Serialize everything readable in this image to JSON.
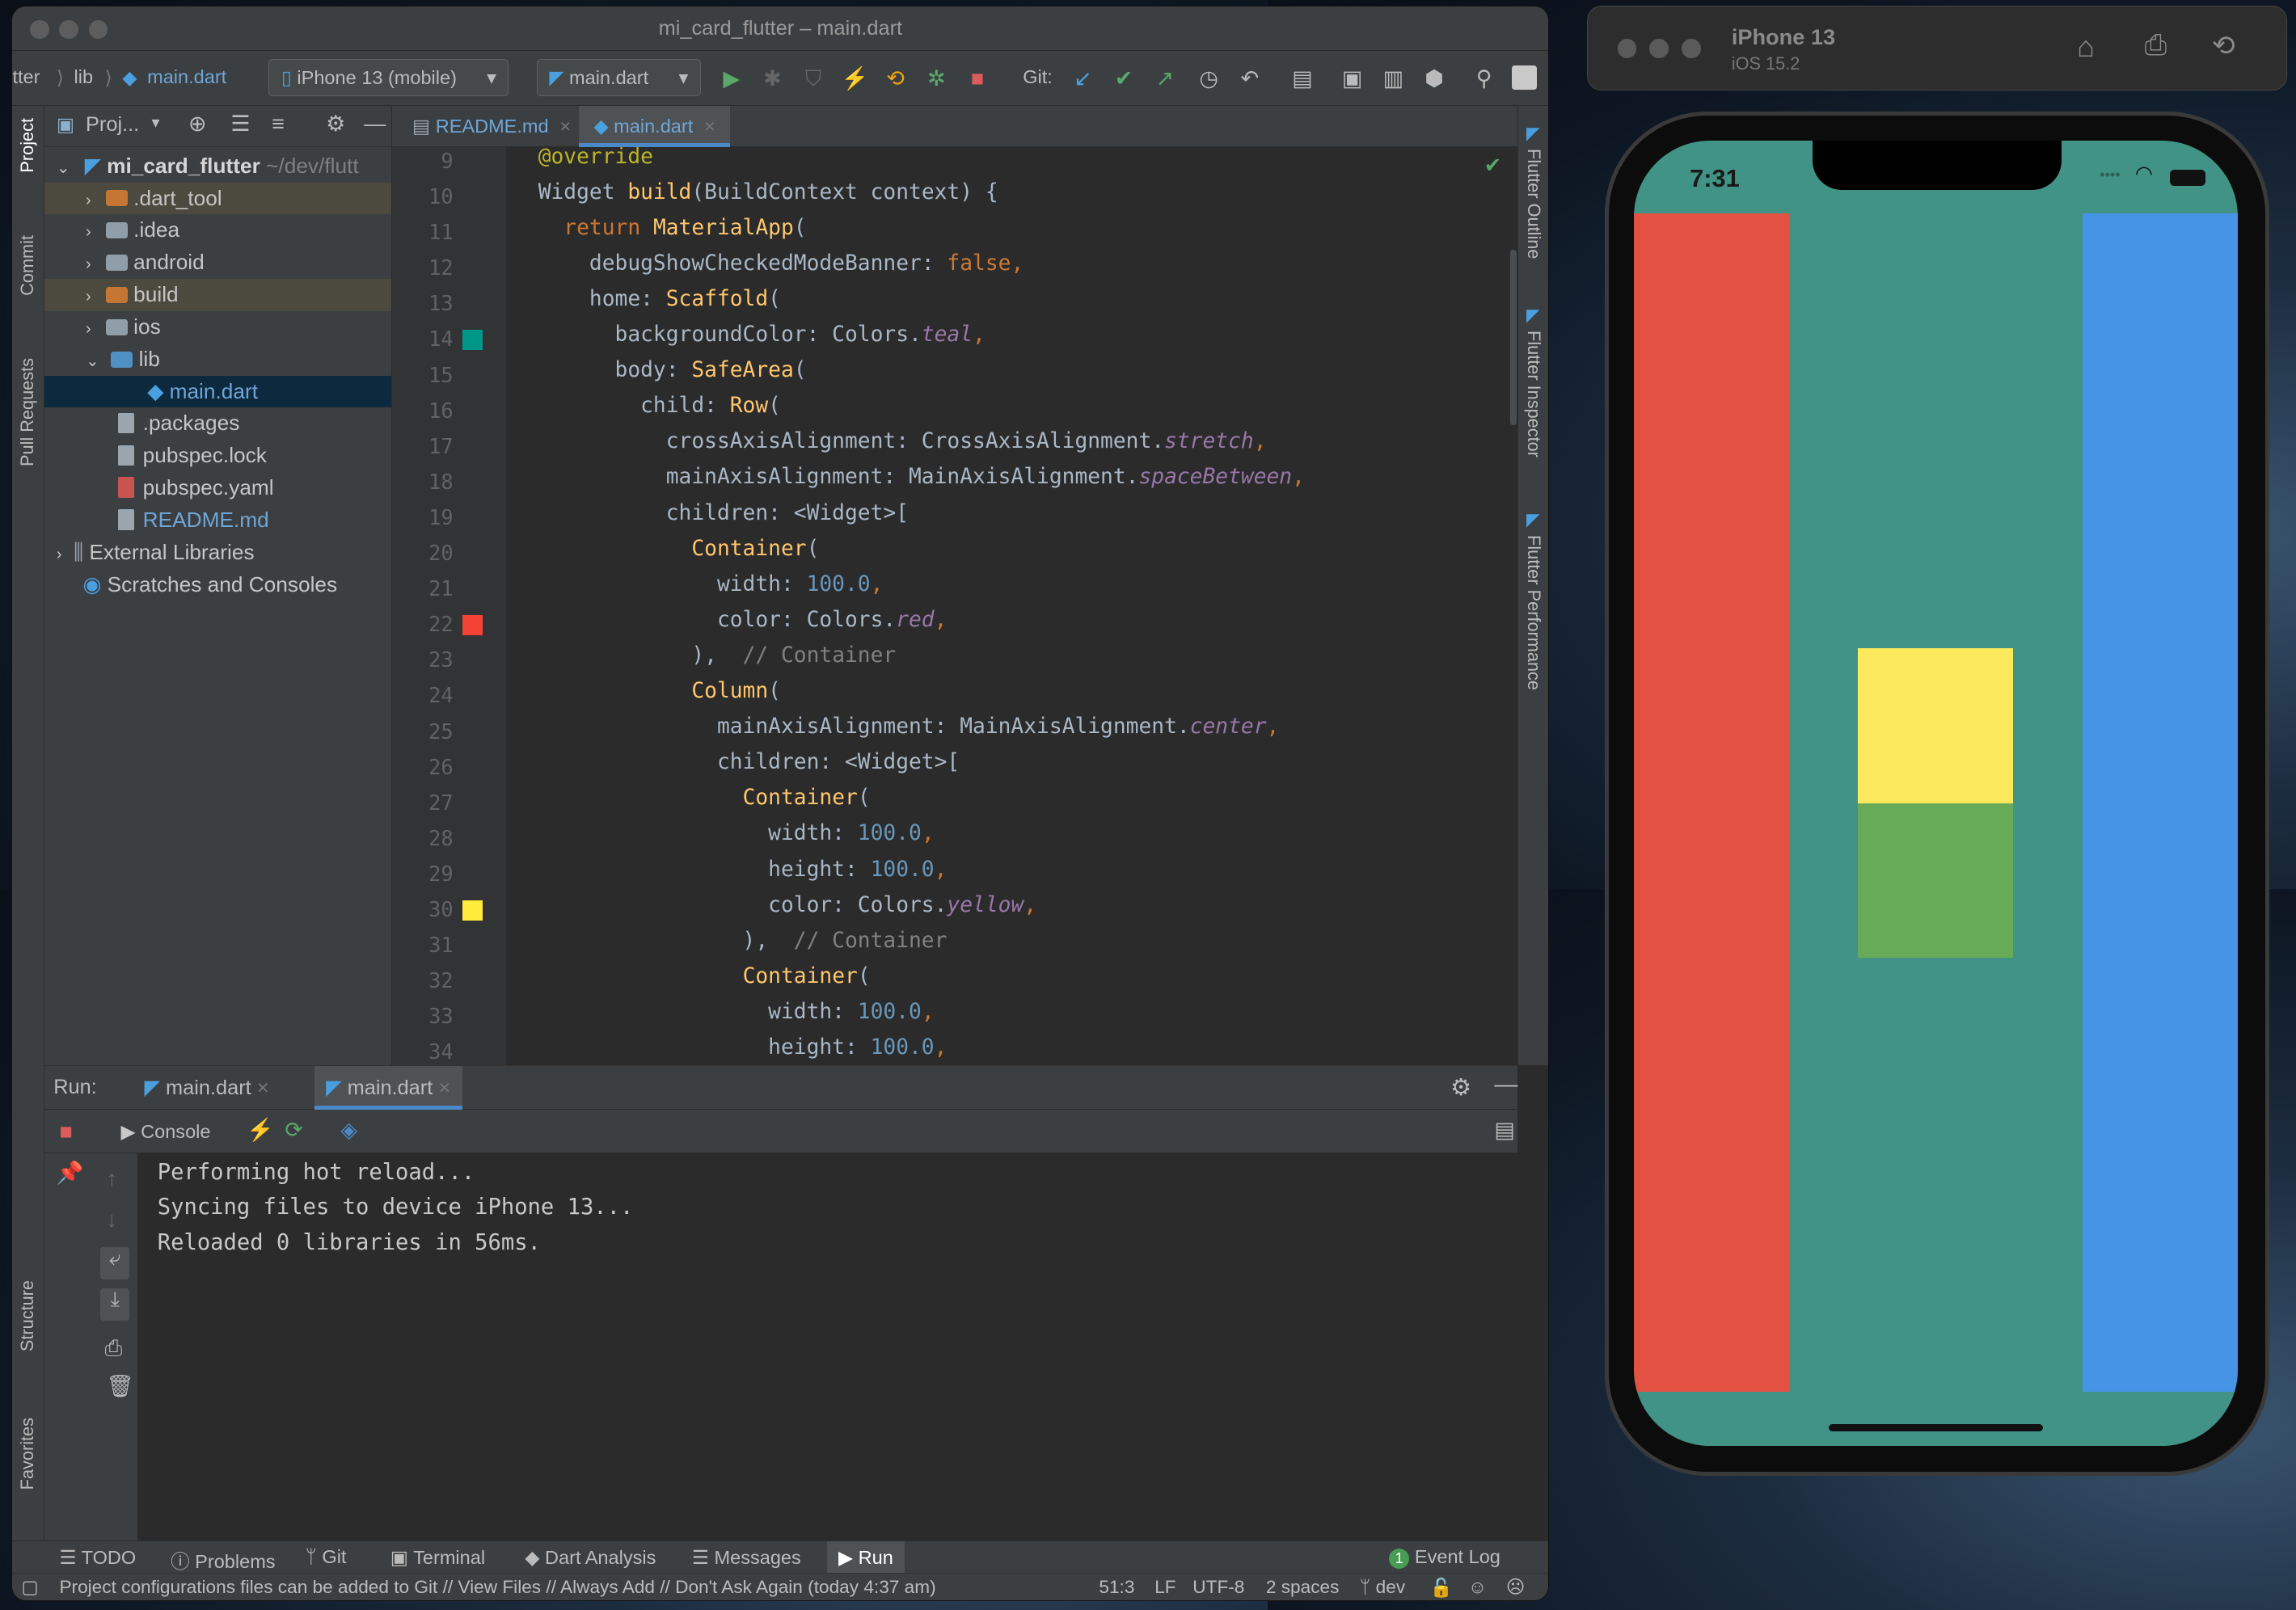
{
  "ide": {
    "window_title": "mi_card_flutter – main.dart",
    "breadcrumb": [
      "tter",
      "lib",
      "main.dart"
    ],
    "device_selector": "iPhone 13 (mobile)",
    "run_config": "main.dart",
    "git_label": "Git:"
  },
  "project_panel": {
    "header": "Proj...",
    "root_name": "mi_card_flutter",
    "root_path": "~/dev/flutt",
    "items": [
      {
        "label": ".dart_tool",
        "type": "folder",
        "color": "#c57633"
      },
      {
        "label": ".idea",
        "type": "folder",
        "color": "#8f9ea8"
      },
      {
        "label": "android",
        "type": "folder",
        "color": "#8f9ea8"
      },
      {
        "label": "build",
        "type": "folder",
        "color": "#c57633"
      },
      {
        "label": "ios",
        "type": "folder",
        "color": "#8f9ea8"
      },
      {
        "label": "lib",
        "type": "folder",
        "color": "#4f90c5"
      },
      {
        "label": "main.dart",
        "type": "dart"
      },
      {
        "label": ".packages",
        "type": "file"
      },
      {
        "label": "pubspec.lock",
        "type": "file"
      },
      {
        "label": "pubspec.yaml",
        "type": "yaml"
      },
      {
        "label": "README.md",
        "type": "md"
      },
      {
        "label": "External Libraries",
        "type": "lib"
      },
      {
        "label": "Scratches and Consoles",
        "type": "scratch"
      }
    ]
  },
  "editor": {
    "tabs": [
      "README.md",
      "main.dart"
    ],
    "active_tab": "main.dart",
    "line_numbers": [
      "9",
      "10",
      "11",
      "12",
      "13",
      "14",
      "15",
      "16",
      "17",
      "18",
      "19",
      "20",
      "21",
      "22",
      "23",
      "24",
      "25",
      "26",
      "27",
      "28",
      "29",
      "30",
      "31",
      "32",
      "33",
      "34"
    ],
    "swatches": {
      "14": "#009688",
      "22": "#f44336",
      "30": "#ffeb3b"
    }
  },
  "run_panel": {
    "run_label": "Run:",
    "tabs": [
      "main.dart",
      "main.dart"
    ],
    "console_label": "Console",
    "output": [
      "Performing hot reload...",
      "Syncing files to device iPhone 13...",
      "Reloaded 0 libraries in 56ms."
    ]
  },
  "left_strip": [
    "Project",
    "Commit",
    "Pull Requests",
    "Structure",
    "Favorites"
  ],
  "right_strip": [
    "Flutter Outline",
    "Flutter Inspector",
    "Flutter Performance"
  ],
  "bottom_tabs": [
    "TODO",
    "Problems",
    "Git",
    "Terminal",
    "Dart Analysis",
    "Messages",
    "Run"
  ],
  "event_log": {
    "label": "Event Log",
    "count": "1"
  },
  "status": {
    "message": "Project configurations files can be added to Git // View Files // Always Add // Don't Ask Again (today 4:37 am)",
    "position": "51:3",
    "line_sep": "LF",
    "encoding": "UTF-8",
    "indent": "2 spaces",
    "branch": "dev"
  },
  "simulator": {
    "device": "iPhone 13",
    "os": "iOS 15.2",
    "time": "7:31",
    "colors": {
      "teal": "#409385",
      "red": "#e35142",
      "blue": "#4594e6",
      "yellow": "#fce85c",
      "green": "#67ab59"
    }
  }
}
